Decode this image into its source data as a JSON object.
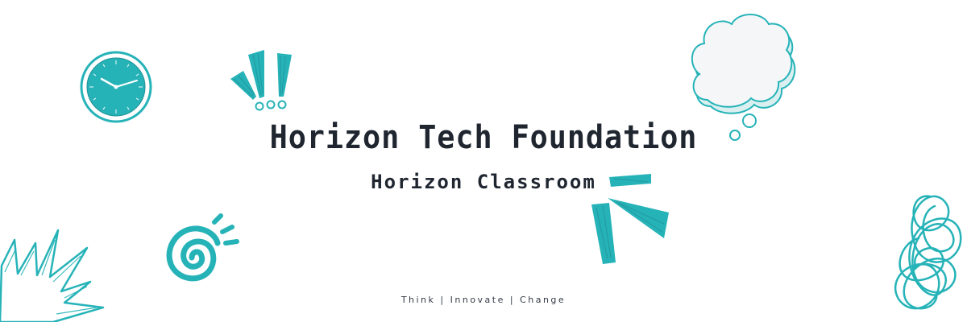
{
  "banner": {
    "title": "Horizon Tech Foundation",
    "subtitle": "Horizon Classroom",
    "tagline": "Think | Innovate | Change"
  },
  "colors": {
    "accent": "#26b3b8",
    "accent_dark": "#1f8f94",
    "text": "#1f2630",
    "background": "#ffffff",
    "cloud_fill": "#f5f6f7"
  },
  "icons": [
    "clock-icon",
    "exclamation-marks-icon",
    "thought-bubble-icon",
    "spiral-icon",
    "burst-lines-icon",
    "zigzag-icon",
    "scribble-icon"
  ]
}
